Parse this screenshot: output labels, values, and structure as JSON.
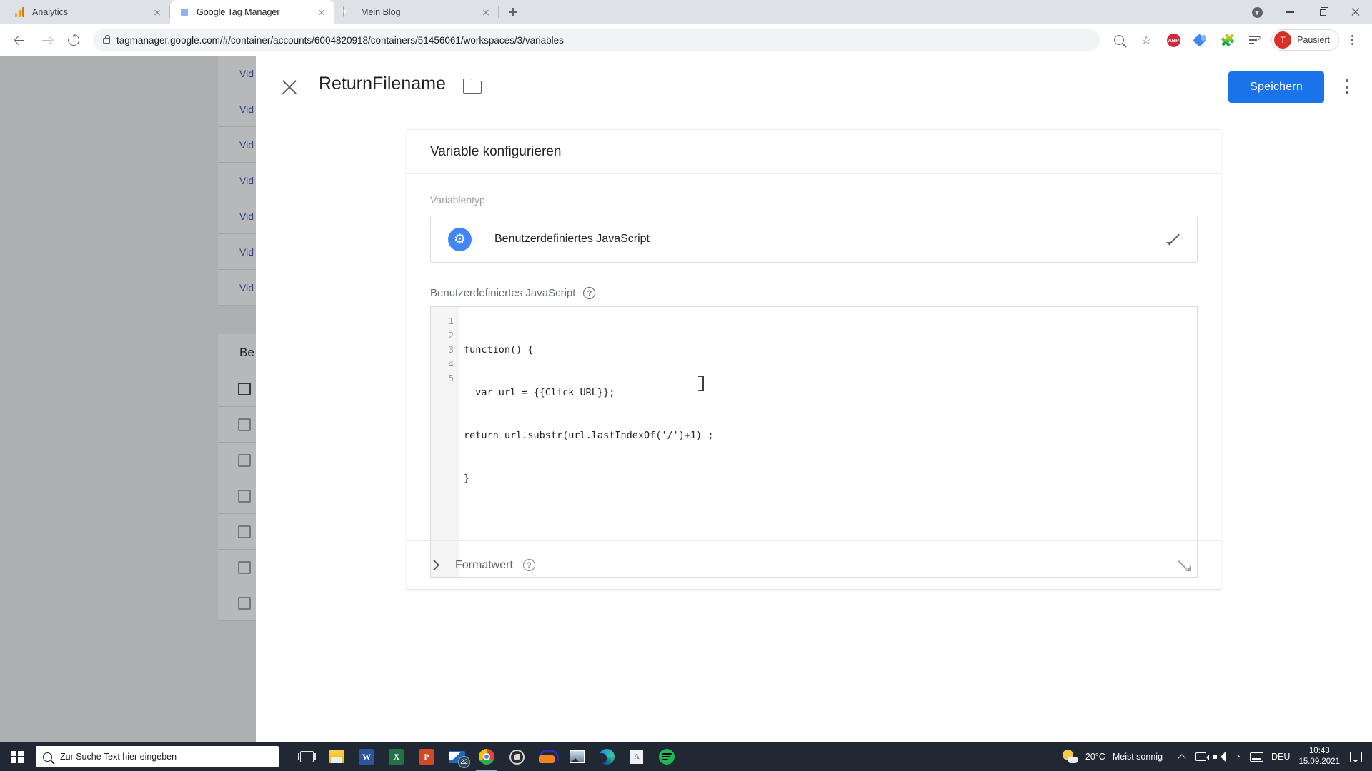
{
  "browser": {
    "tabs": [
      {
        "title": "Analytics",
        "favicon": "analytics-icon",
        "active": false
      },
      {
        "title": "Google Tag Manager",
        "favicon": "gtm-icon",
        "active": true
      },
      {
        "title": "Mein Blog",
        "favicon": "wordpress-icon",
        "active": false
      }
    ],
    "url": "tagmanager.google.com/#/container/accounts/6004820918/containers/51456061/workspaces/3/variables",
    "profile_label": "Pausiert",
    "profile_initial": "T",
    "extensions": [
      "abp-icon",
      "tag-assistant-icon",
      "puzzle-icon",
      "reading-list-icon"
    ],
    "nav_icons": [
      "back-icon",
      "forward-icon",
      "reload-icon"
    ],
    "omnibox_icons": [
      "lock-icon",
      "zoom-icon",
      "bookmark-star-icon"
    ],
    "window_controls": [
      "update-icon",
      "minimize-icon",
      "maximize-icon",
      "close-icon"
    ],
    "abp_label": "ABP"
  },
  "gtm": {
    "title": "ReturnFilename",
    "save_label": "Speichern",
    "card_title": "Variable konfigurieren",
    "variable_type_label": "Variablentyp",
    "variable_type_name": "Benutzerdefiniertes JavaScript",
    "js_label": "Benutzerdefiniertes JavaScript",
    "help_glyph": "?",
    "format_label": "Formatwert",
    "code": {
      "line_numbers": [
        "1",
        "2",
        "3",
        "4",
        "5"
      ],
      "lines": [
        "function() {",
        "  var url = {{Click URL}};",
        "return url.substr(url.lastIndexOf('/')+1) ;",
        "}",
        ""
      ]
    }
  },
  "background": {
    "rows": [
      "Vid",
      "Vid",
      "Vid",
      "Vid",
      "Vid",
      "Vid",
      "Vid"
    ],
    "section_heading": "Be",
    "checkbox_rows": 7
  },
  "taskbar": {
    "search_placeholder": "Zur Suche Text hier eingeben",
    "apps": [
      "task-view-icon",
      "file-explorer-icon",
      "word-icon",
      "excel-icon",
      "powerpoint-icon",
      "mail-icon",
      "chrome-icon",
      "obs-icon",
      "audio-app-icon",
      "photo-app-icon",
      "edge-icon",
      "document-app-icon",
      "spotify-icon"
    ],
    "mail_badge": "22",
    "word_letter": "W",
    "excel_letter": "X",
    "powerpoint_letter": "P",
    "weather_temp": "20°C",
    "weather_desc": "Meist sonnig",
    "language": "DEU",
    "time": "10:43",
    "date": "15.09.2021",
    "tray_icons": [
      "caret-up-icon",
      "camera-icon",
      "volume-icon",
      "wifi-icon",
      "keyboard-icon",
      "notification-icon"
    ]
  },
  "colors": {
    "accent_blue": "#1a73e8",
    "chrome_bg": "#dee1e6",
    "taskbar_bg": "#1f2833",
    "abp_red": "#d3293a",
    "avatar_red": "#d93025"
  }
}
